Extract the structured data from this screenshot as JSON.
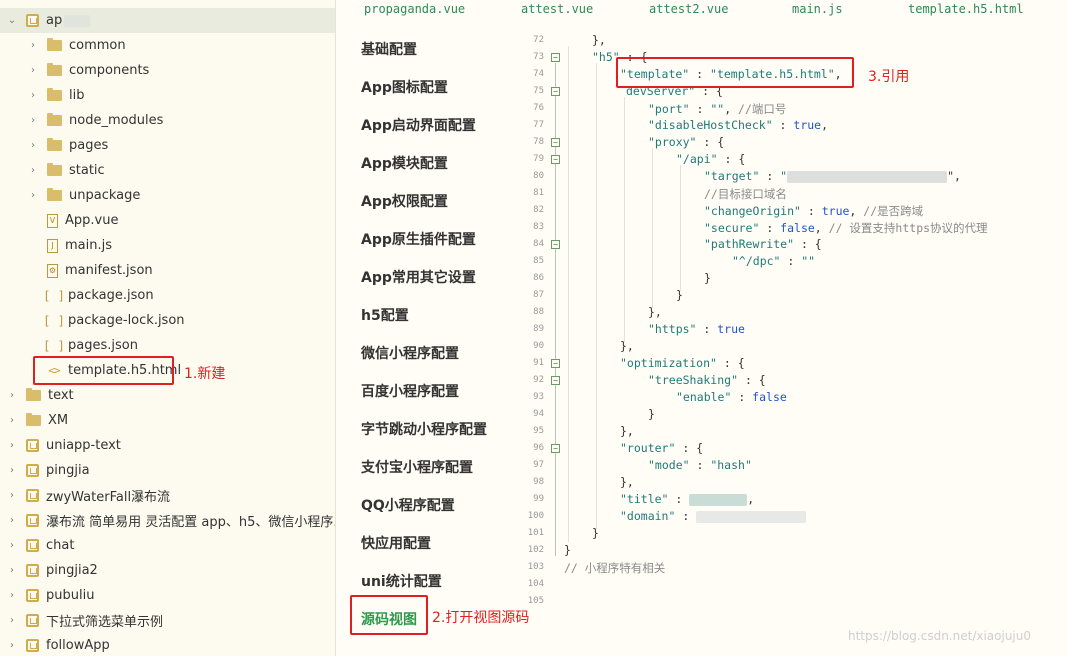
{
  "explorer": {
    "items": [
      {
        "label": "ap",
        "type": "project",
        "expanded": true,
        "indent": 0
      },
      {
        "label": "common",
        "type": "folder",
        "indent": 1
      },
      {
        "label": "components",
        "type": "folder",
        "indent": 1
      },
      {
        "label": "lib",
        "type": "folder",
        "indent": 1
      },
      {
        "label": "node_modules",
        "type": "folder",
        "indent": 1
      },
      {
        "label": "pages",
        "type": "folder",
        "indent": 1
      },
      {
        "label": "static",
        "type": "folder",
        "indent": 1
      },
      {
        "label": "unpackage",
        "type": "folder",
        "indent": 1
      },
      {
        "label": "App.vue",
        "type": "vue",
        "indent": 1
      },
      {
        "label": "main.js",
        "type": "js",
        "indent": 1
      },
      {
        "label": "manifest.json",
        "type": "manifest",
        "indent": 1
      },
      {
        "label": "package.json",
        "type": "json",
        "indent": 1
      },
      {
        "label": "package-lock.json",
        "type": "json",
        "indent": 1
      },
      {
        "label": "pages.json",
        "type": "json",
        "indent": 1
      },
      {
        "label": "template.h5.html",
        "type": "html",
        "indent": 1
      },
      {
        "label": "text",
        "type": "textfolder",
        "indent": 0
      },
      {
        "label": "XM",
        "type": "textfolder",
        "indent": 0
      },
      {
        "label": "uniapp-text",
        "type": "project",
        "indent": 0
      },
      {
        "label": "pingjia",
        "type": "project",
        "indent": 0
      },
      {
        "label": "zwyWaterFall瀑布流",
        "type": "project",
        "indent": 0
      },
      {
        "label": "瀑布流 简单易用 灵活配置  app、h5、微信小程序...",
        "type": "project",
        "indent": 0
      },
      {
        "label": "chat",
        "type": "project",
        "indent": 0
      },
      {
        "label": "pingjia2",
        "type": "project",
        "indent": 0
      },
      {
        "label": "pubuliu",
        "type": "project",
        "indent": 0
      },
      {
        "label": "下拉式筛选菜单示例",
        "type": "project",
        "indent": 0
      },
      {
        "label": "followApp",
        "type": "project",
        "indent": 0
      }
    ]
  },
  "tabs": [
    "propaganda.vue",
    "attest.vue",
    "attest2.vue",
    "main.js",
    "template.h5.html"
  ],
  "settings_nav": {
    "items": [
      "基础配置",
      "App图标配置",
      "App启动界面配置",
      "App模块配置",
      "App权限配置",
      "App原生插件配置",
      "App常用其它设置",
      "h5配置",
      "微信小程序配置",
      "百度小程序配置",
      "字节跳动小程序配置",
      "支付宝小程序配置",
      "QQ小程序配置",
      "快应用配置",
      "uni统计配置",
      "源码视图"
    ],
    "active": "源码视图"
  },
  "editor": {
    "line_numbers": [
      "72",
      "73",
      "74",
      "75",
      "76",
      "77",
      "78",
      "79",
      "80",
      "81",
      "82",
      "83",
      "84",
      "85",
      "86",
      "87",
      "88",
      "89",
      "90",
      "91",
      "92",
      "93",
      "94",
      "95",
      "96",
      "97",
      "98",
      "99",
      "100",
      "101",
      "102",
      "103",
      "104",
      "105"
    ],
    "lines": {
      "l72": "},",
      "l73_key": "\"h5\"",
      "l73_rest": " : {",
      "l74_key": "\"template\"",
      "l74_sep": " : ",
      "l74_val": "\"template.h5.html\"",
      "l74_end": ",",
      "l75_key": "devServer\"",
      "l75_rest": " : {",
      "l76_key": "\"port\"",
      "l76_sep": " : ",
      "l76_val": "\"\"",
      "l76_end": ", ",
      "l76_comment": "//端口号",
      "l77_key": "\"disableHostCheck\"",
      "l77_sep": " : ",
      "l77_val": "true",
      "l77_end": ",",
      "l78_key": "\"proxy\"",
      "l78_rest": " : {",
      "l79_key": "\"/api\"",
      "l79_rest": " : {",
      "l80_key": "\"target\"",
      "l80_sep": " : ",
      "l80_val_start": "\"",
      "l80_end": "\",",
      "l81_comment": "//目标接口域名",
      "l82_key": "\"changeOrigin\"",
      "l82_sep": " : ",
      "l82_val": "true",
      "l82_end": ", ",
      "l82_comment": "//是否跨域",
      "l83_key": "\"secure\"",
      "l83_sep": " : ",
      "l83_val": "false",
      "l83_end": ", ",
      "l83_comment": "// 设置支持https协议的代理",
      "l84_key": "\"pathRewrite\"",
      "l84_rest": " : {",
      "l85_key": "\"^/dpc\"",
      "l85_sep": " : ",
      "l85_val": "\"\"",
      "l86": "}",
      "l87": "}",
      "l88": "},",
      "l89_key": "\"https\"",
      "l89_sep": " : ",
      "l89_val": "true",
      "l90": "},",
      "l91_key": "\"optimization\"",
      "l91_rest": " : {",
      "l92_key": "\"treeShaking\"",
      "l92_rest": " : {",
      "l93_key": "\"enable\"",
      "l93_sep": " : ",
      "l93_val": "false",
      "l94": "}",
      "l95": "},",
      "l96_key": "\"router\"",
      "l96_rest": " : {",
      "l97_key": "\"mode\"",
      "l97_sep": " : ",
      "l97_val": "\"hash\"",
      "l98": "},",
      "l99_key": "\"title\"",
      "l99_sep": " : ",
      "l99_end": ",",
      "l100_key": "\"domain\"",
      "l100_sep": " : ",
      "l101": "}",
      "l102": "}",
      "l103_comment": "// 小程序特有相关"
    }
  },
  "annotations": {
    "step1": "1.新建",
    "step2": "2.打开视图源码",
    "step3": "3.引用"
  },
  "watermark": "https://blog.csdn.net/xiaojuju0",
  "colors": {
    "annotation_red": "#e02020",
    "active_nav_green": "#2e9a4c",
    "tab_green": "#2b8a5a",
    "json_key": "#1f7a7a",
    "json_bool": "#2255cc"
  }
}
